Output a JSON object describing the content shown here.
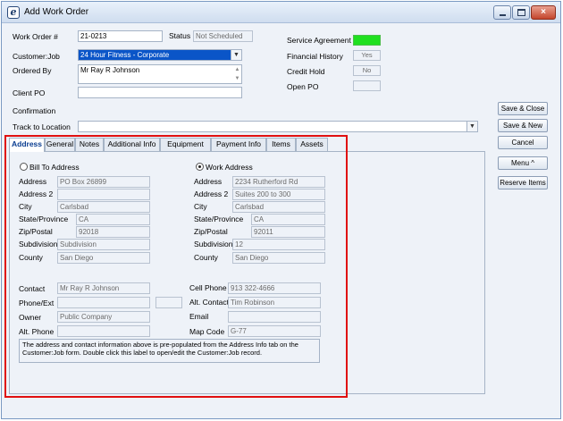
{
  "window": {
    "title": "Add Work Order",
    "min_glyph": "",
    "max_glyph": "",
    "close_glyph": "×"
  },
  "header": {
    "work_order_label": "Work Order #",
    "work_order_value": "21-0213",
    "status_label": "Status",
    "status_value": "Not Scheduled",
    "customer_job_label": "Customer:Job",
    "customer_job_value": "24 Hour Fitness - Corporate",
    "ordered_by_label": "Ordered By",
    "ordered_by_value": "Mr Ray R Johnson",
    "client_po_label": "Client PO",
    "client_po_value": "",
    "confirmation_label": "Confirmation",
    "track_location_label": "Track to Location",
    "track_location_value": ""
  },
  "flags": {
    "service_agreement_label": "Service Agreement",
    "service_agreement_value": "Yes",
    "financial_history_label": "Financial History",
    "financial_history_value": "Yes",
    "credit_hold_label": "Credit Hold",
    "credit_hold_value": "No",
    "open_po_label": "Open PO",
    "open_po_value": "",
    "active_color": "#20e020"
  },
  "side_buttons": {
    "save_close": "Save & Close",
    "save_new": "Save & New",
    "cancel": "Cancel",
    "menu": "Menu ^",
    "reserve_items": "Reserve Items"
  },
  "tabs": [
    "Address",
    "General",
    "Notes",
    "Additional Info",
    "Equipment",
    "Payment Info",
    "Items",
    "Assets"
  ],
  "address": {
    "bill_to_label": "Bill To Address",
    "work_address_label": "Work Address",
    "selected": "Work Address",
    "field_labels": {
      "address": "Address",
      "address2": "Address 2",
      "city": "City",
      "state": "State/Province",
      "zip": "Zip/Postal",
      "subdivision": "Subdivision",
      "county": "County"
    },
    "bill_to": {
      "address": "PO Box 26899",
      "address2": "",
      "city": "Carlsbad",
      "state": "CA",
      "zip": "92018",
      "subdivision": "Subdivision",
      "county": "San Diego"
    },
    "work": {
      "address": "2234 Rutherford Rd",
      "address2": "Suites 200 to 300",
      "city": "Carlsbad",
      "state": "CA",
      "zip": "92011",
      "subdivision": "12",
      "county": "San Diego"
    }
  },
  "contact": {
    "contact_label": "Contact",
    "contact_value": "Mr Ray R Johnson",
    "phone_ext_label": "Phone/Ext",
    "phone_value": "",
    "ext_value": "",
    "owner_label": "Owner",
    "owner_value": "Public Company",
    "alt_phone_label": "Alt. Phone",
    "alt_phone_value": "",
    "cell_phone_label": "Cell Phone",
    "cell_phone_value": "913 322-4666",
    "alt_contact_label": "Alt. Contact",
    "alt_contact_value": "Tim Robinson",
    "email_label": "Email",
    "email_value": "",
    "map_code_label": "Map Code",
    "map_code_value": "G-77"
  },
  "note": "The address and contact information above is pre-populated from the Address Info tab on the Customer:Job form. Double click this label to open/edit the Customer:Job record."
}
